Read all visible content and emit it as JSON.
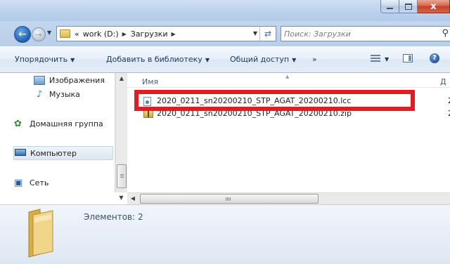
{
  "titlebar": {
    "min_icon": "minimize-icon",
    "max_icon": "maximize-icon",
    "close_label": "x"
  },
  "address": {
    "overflow": "«",
    "crumbs": [
      "work (D:)",
      "Загрузки"
    ],
    "search_placeholder": "Поиск: Загрузки"
  },
  "toolbar": {
    "organize": "Упорядочить",
    "add_to_library": "Добавить в библиотеку",
    "share": "Общий доступ",
    "more": "»"
  },
  "nav": {
    "items": [
      {
        "label": "Изображения",
        "icon": "pictures-icon"
      },
      {
        "label": "Музыка",
        "icon": "music-icon"
      },
      {
        "label": "Домашняя группа",
        "icon": "homegroup-icon"
      },
      {
        "label": "Компьютер",
        "icon": "computer-icon"
      },
      {
        "label": "Сеть",
        "icon": "network-icon"
      }
    ]
  },
  "list": {
    "column_name": "Имя",
    "column_next_partial": "Д",
    "files": [
      {
        "name": "2020_0211_sn20200210_STP_AGAT_20200210.lcc",
        "right": "2",
        "icon": "lcc-file-icon"
      },
      {
        "name": "2020_0211_sn20200210_STP_AGAT_20200210.zip",
        "right": "2",
        "icon": "zip-archive-icon"
      }
    ]
  },
  "scroll": {
    "h_thumb_label": "III"
  },
  "details": {
    "count_text": "Элементов: 2"
  },
  "colors": {
    "highlight": "#e31b23",
    "close": "#c2412a"
  }
}
